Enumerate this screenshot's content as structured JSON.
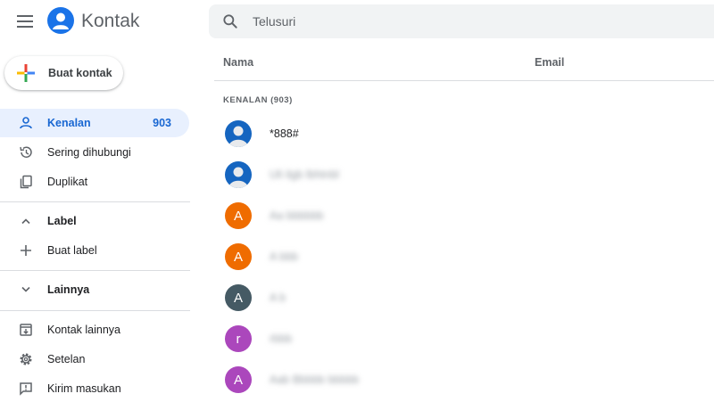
{
  "header": {
    "menu_icon": "hamburger-menu-icon",
    "logo_icon": "contacts-person-icon",
    "app_title": "Kontak",
    "search_placeholder": "Telusuri"
  },
  "create_button": {
    "label": "Buat kontak",
    "icon": "colored-plus-icon"
  },
  "sidebar": {
    "items": [
      {
        "label": "Kenalan",
        "count": "903",
        "icon": "person-icon",
        "active": true
      },
      {
        "label": "Sering dihubungi",
        "icon": "history-icon"
      },
      {
        "label": "Duplikat",
        "icon": "copy-icon"
      }
    ],
    "label_section": {
      "label": "Label",
      "icon": "chevron-up-icon"
    },
    "create_label": {
      "label": "Buat label",
      "icon": "plus-icon"
    },
    "more_section": {
      "label": "Lainnya",
      "icon": "chevron-down-icon"
    },
    "bottom_items": [
      {
        "label": "Kontak lainnya",
        "icon": "archive-icon"
      },
      {
        "label": "Setelan",
        "icon": "gear-icon"
      },
      {
        "label": "Kirim masukan",
        "icon": "feedback-icon"
      }
    ]
  },
  "main": {
    "columns": {
      "name": "Nama",
      "email": "Email"
    },
    "section_label": "KENALAN (903)",
    "contacts": [
      {
        "name": "*888#",
        "avatar": "photo",
        "color": "#1565c0"
      },
      {
        "name": "Uli ilgb lbhtnbl",
        "avatar": "photo",
        "color": "#1565c0",
        "blurred": true
      },
      {
        "initial": "A",
        "name": "Aa bbbbbb",
        "color": "#ef6c00",
        "blurred": true
      },
      {
        "initial": "A",
        "name": "A bbb",
        "color": "#ef6c00",
        "blurred": true
      },
      {
        "initial": "A",
        "name": "A b",
        "color": "#455a64",
        "blurred": true
      },
      {
        "initial": "r",
        "name": "rbbb",
        "color": "#ab47bc",
        "blurred": true
      },
      {
        "initial": "A",
        "name": "Aab Bbbbb bbbbb",
        "color": "#ab47bc",
        "blurred": true
      }
    ]
  },
  "colors": {
    "accent": "#1a73e8",
    "active_bg": "#e8f0fe",
    "active_text": "#1967d2"
  }
}
